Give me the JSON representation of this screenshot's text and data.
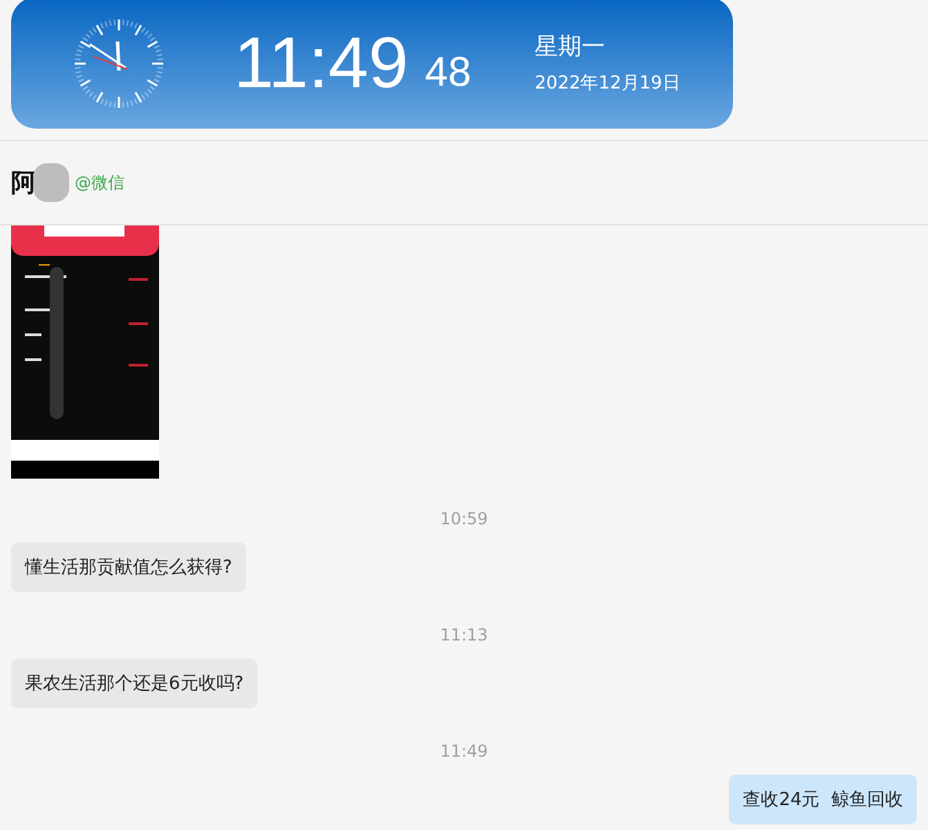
{
  "clock_widget": {
    "time": "11:49",
    "seconds": "48",
    "weekday": "星期一",
    "date": "2022年12月19日"
  },
  "chat_header": {
    "name": "阿",
    "source": "@微信"
  },
  "messages": [
    {
      "kind": "picture"
    },
    {
      "kind": "time",
      "text": "10:59"
    },
    {
      "kind": "incoming",
      "text": "懂生活那贡献值怎么获得?"
    },
    {
      "kind": "time",
      "text": "11:13"
    },
    {
      "kind": "incoming",
      "text": "果农生活那个还是6元收吗?"
    },
    {
      "kind": "time",
      "text": "11:49"
    },
    {
      "kind": "outgoing",
      "text": "查收24元  鲸鱼回收"
    }
  ]
}
